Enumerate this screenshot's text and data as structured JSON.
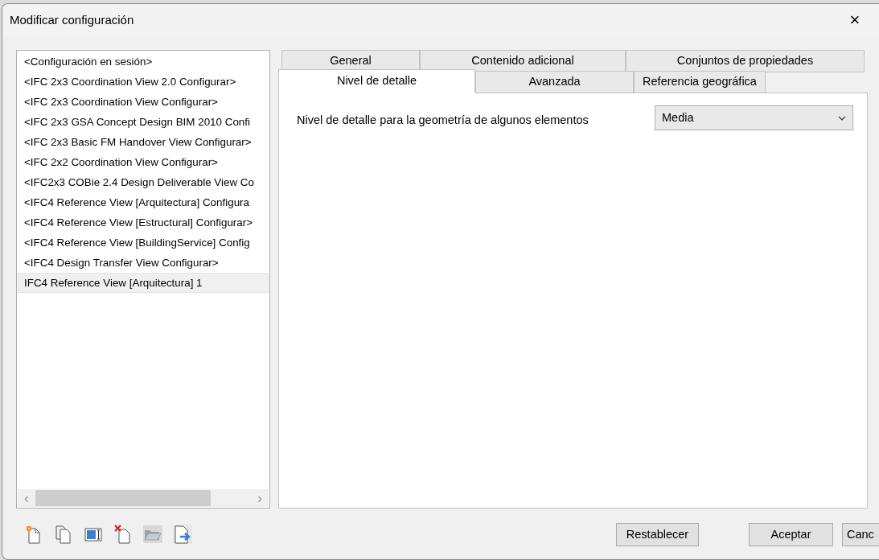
{
  "window": {
    "title": "Modificar configuración",
    "close": "×"
  },
  "configurations": {
    "items": [
      {
        "label": "<Configuración en sesión>",
        "selected": false
      },
      {
        "label": "<IFC 2x3 Coordination View 2.0 Configurar>",
        "selected": false
      },
      {
        "label": "<IFC 2x3 Coordination View Configurar>",
        "selected": false
      },
      {
        "label": "<IFC 2x3 GSA Concept Design BIM 2010 Confi",
        "selected": false
      },
      {
        "label": "<IFC 2x3 Basic FM Handover View Configurar>",
        "selected": false
      },
      {
        "label": "<IFC 2x2 Coordination View Configurar>",
        "selected": false
      },
      {
        "label": "<IFC2x3 COBie 2.4 Design Deliverable View Co",
        "selected": false
      },
      {
        "label": "<IFC4 Reference View [Arquitectura] Configura",
        "selected": false
      },
      {
        "label": "<IFC4 Reference View [Estructural] Configurar>",
        "selected": false
      },
      {
        "label": "<IFC4 Reference View [BuildingService] Config",
        "selected": false
      },
      {
        "label": "<IFC4 Design Transfer View Configurar>",
        "selected": false
      },
      {
        "label": "IFC4 Reference View [Arquitectura] 1",
        "selected": true
      }
    ],
    "scroll_left": "‹",
    "scroll_right": "›"
  },
  "toolbar": [
    {
      "kind": "new"
    },
    {
      "kind": "duplicate"
    },
    {
      "kind": "rename"
    },
    {
      "kind": "delete"
    },
    {
      "kind": "open"
    },
    {
      "kind": "export"
    }
  ],
  "tabs": {
    "rows": [
      [
        {
          "label": "General",
          "selected": false
        },
        {
          "label": "Contenido adicional",
          "selected": false
        },
        {
          "label": "Conjuntos de propiedades",
          "selected": false
        }
      ],
      [
        {
          "label": "Nivel de detalle",
          "selected": true
        },
        {
          "label": "Avanzada",
          "selected": false
        },
        {
          "label": "Referencia geográfica",
          "selected": false
        }
      ]
    ]
  },
  "detail": {
    "label": "Nivel de detalle para la geometría de algunos elementos",
    "value": "Media"
  },
  "buttons": [
    {
      "label": "Restablecer",
      "kind": "reset"
    },
    {
      "label": "Aceptar",
      "kind": "ok"
    },
    {
      "label": "Canc",
      "kind": "cut"
    }
  ]
}
